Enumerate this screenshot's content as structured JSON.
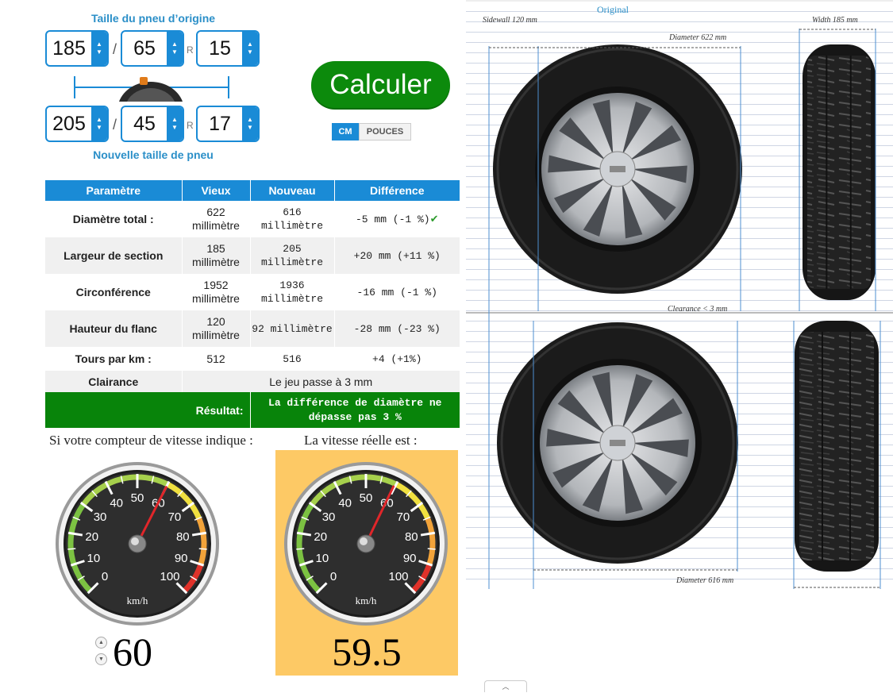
{
  "original_section": {
    "title": "Taille du pneu d’origine"
  },
  "new_section": {
    "title": "Nouvelle taille de pneu"
  },
  "original_size": {
    "width": "185",
    "ratio": "65",
    "rim": "15"
  },
  "new_size": {
    "width": "205",
    "ratio": "45",
    "rim": "17"
  },
  "separators": {
    "slash": "/",
    "r": "R"
  },
  "calc_button": "Calculer",
  "units": {
    "active": "CM",
    "inactive": "POUCES"
  },
  "table": {
    "headers": [
      "Paramètre",
      "Vieux",
      "Nouveau",
      "Différence"
    ],
    "rows": [
      {
        "param": "Diamètre total :",
        "old": "622 millimètre",
        "new": "616 millimètre",
        "diff": "-5 mm (-1 %)"
      },
      {
        "param": "Largeur de section",
        "old": "185 millimètre",
        "new": "205 millimètre",
        "diff": "+20 mm (+11 %)"
      },
      {
        "param": "Circonférence",
        "old": "1952 millimètre",
        "new": "1936 millimètre",
        "diff": "-16 mm (-1 %)"
      },
      {
        "param": "Hauteur du flanc",
        "old": "120 millimètre",
        "new": "92 millimètre",
        "diff": "-28 mm (-23 %)"
      },
      {
        "param": "Tours par km :",
        "old": "512",
        "new": "516",
        "diff": "+4 (+1%)"
      }
    ],
    "clearance_label": "Clairance",
    "clearance_value": "Le jeu passe à 3 mm",
    "result_label": "Résultat:",
    "result_value": "La différence de diamètre ne dépasse pas 3 %"
  },
  "speed": {
    "indicated_label": "Si votre compteur de vitesse indique :",
    "real_label": "La vitesse réelle est :",
    "indicated_value": "60",
    "real_value": "59.5",
    "unit": "km/h",
    "dial_labels": [
      "0",
      "10",
      "20",
      "30",
      "40",
      "50",
      "60",
      "70",
      "80",
      "90",
      "100"
    ],
    "indicated_needle": 60,
    "real_needle": 59.5
  },
  "diagram": {
    "original_label": "Original",
    "sidewall": "Sidewall 120 mm",
    "width": "Width 185 mm",
    "diameter_orig": "Diameter 622 mm",
    "clearance": "Clearance < 3 mm",
    "diameter_new": "Diameter 616 mm"
  },
  "colors": {
    "accent": "#1a8bd6",
    "calc_green": "#0c8a0c",
    "result_green": "#08840a",
    "section_title": "#2b8fc8",
    "real_speed_bg": "#fdc965"
  }
}
